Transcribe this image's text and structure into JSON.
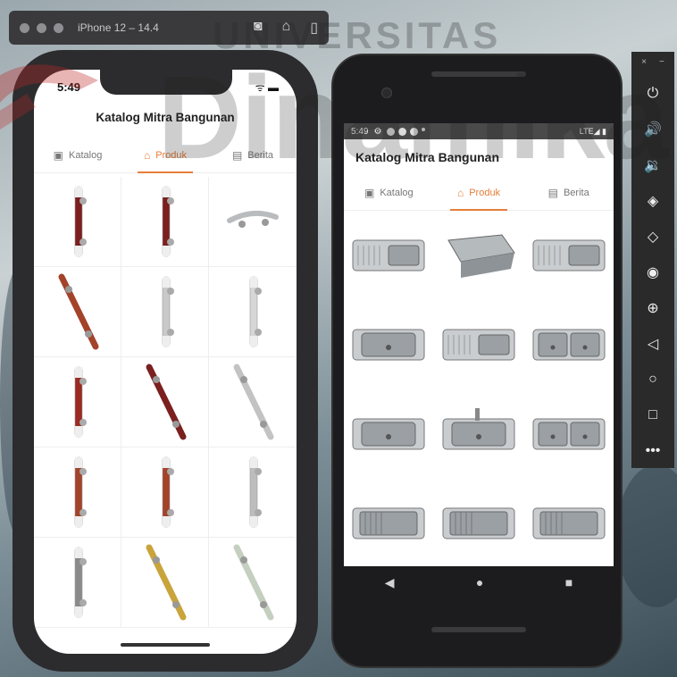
{
  "watermark": {
    "top": "UNIVERSITAS",
    "brand": "Dinamika"
  },
  "simulator": {
    "title": "iPhone 12 – 14.4",
    "tools": [
      {
        "name": "screenshot-icon",
        "glyph": "◙"
      },
      {
        "name": "home-icon",
        "glyph": "⌂"
      },
      {
        "name": "rotate-icon",
        "glyph": "▯"
      }
    ]
  },
  "ios": {
    "time": "5:49",
    "status": "ᯤ ▬",
    "title": "Katalog Mitra Bangunan",
    "tabs": [
      {
        "label": "Katalog",
        "icon": "▣",
        "active": false
      },
      {
        "label": "Produk",
        "icon": "⌂",
        "active": true
      },
      {
        "label": "Berita",
        "icon": "▤",
        "active": false
      }
    ],
    "products": [
      {
        "type": "handle",
        "color": "#7b1f1f"
      },
      {
        "type": "handle",
        "color": "#7b1f1f"
      },
      {
        "type": "curve",
        "color": "#b9bcbf"
      },
      {
        "type": "diag",
        "color": "#a3432a"
      },
      {
        "type": "handle",
        "color": "#c9c9c9"
      },
      {
        "type": "handle",
        "color": "#d6d6d6"
      },
      {
        "type": "handle",
        "color": "#9b2a22"
      },
      {
        "type": "diag",
        "color": "#7b1f1f"
      },
      {
        "type": "diag",
        "color": "#c3c3c3"
      },
      {
        "type": "handle",
        "color": "#a3432a"
      },
      {
        "type": "handle",
        "color": "#a3432a"
      },
      {
        "type": "handle",
        "color": "#bdbdbd"
      },
      {
        "type": "handle",
        "color": "#8a8a8a"
      },
      {
        "type": "diag",
        "color": "#c9a43a"
      },
      {
        "type": "diag",
        "color": "#c5cfbf"
      }
    ]
  },
  "android": {
    "status_time": "5:49",
    "status_right": "LTE◢ ▮",
    "title": "Katalog Mitra Bangunan",
    "tabs": [
      {
        "label": "Katalog",
        "icon": "▣",
        "active": false
      },
      {
        "label": "Produk",
        "icon": "⌂",
        "active": true
      },
      {
        "label": "Berita",
        "icon": "▤",
        "active": false
      }
    ],
    "sinks": [
      "drainboard",
      "deep",
      "drainboard",
      "single",
      "drainboard",
      "double",
      "single",
      "faucet",
      "double",
      "rack",
      "rack",
      "rack"
    ],
    "nav": [
      "◀",
      "●",
      "■"
    ]
  },
  "emulator_bar": {
    "top": [
      "×",
      "−"
    ],
    "buttons": [
      {
        "name": "power-icon",
        "glyph": "⏻"
      },
      {
        "name": "volume-up-icon",
        "glyph": "🔊"
      },
      {
        "name": "volume-down-icon",
        "glyph": "🔉"
      },
      {
        "name": "rotate-left-icon",
        "glyph": "◈"
      },
      {
        "name": "rotate-right-icon",
        "glyph": "◇"
      },
      {
        "name": "camera-icon",
        "glyph": "◉"
      },
      {
        "name": "zoom-icon",
        "glyph": "⊕"
      },
      {
        "name": "back-icon",
        "glyph": "◁"
      },
      {
        "name": "home-icon",
        "glyph": "○"
      },
      {
        "name": "overview-icon",
        "glyph": "□"
      },
      {
        "name": "more-icon",
        "glyph": "•••"
      }
    ]
  }
}
